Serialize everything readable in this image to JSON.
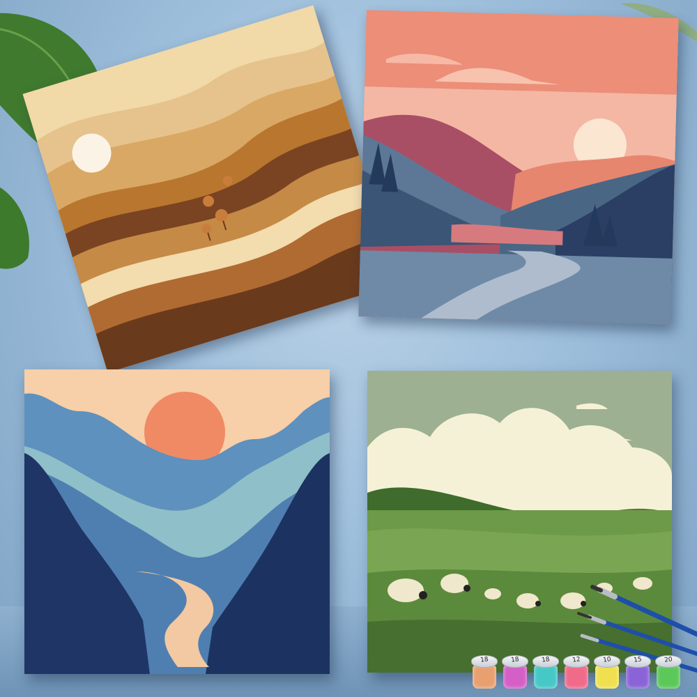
{
  "scene": {
    "paintings": [
      {
        "name": "desert-hills-painting",
        "subject": "layered brown and sand rolling hills with white sun and small trees"
      },
      {
        "name": "sunset-river-valley-painting",
        "subject": "pink sky, mountains, pale sun and winding river"
      },
      {
        "name": "blue-mountain-valley-painting",
        "subject": "peach sky, orange sun, blue mountains and winding path"
      },
      {
        "name": "sheep-meadow-painting",
        "subject": "green meadow with clouds, trees and grazing sheep"
      }
    ],
    "paint_pots": [
      {
        "label": "18",
        "color": "#e9a070"
      },
      {
        "label": "18",
        "color": "#d45fc6"
      },
      {
        "label": "18",
        "color": "#46c8c6"
      },
      {
        "label": "12",
        "color": "#f06a8a"
      },
      {
        "label": "10",
        "color": "#f0e050"
      },
      {
        "label": "15",
        "color": "#8a64d6"
      },
      {
        "label": "20",
        "color": "#5cc85a"
      }
    ]
  },
  "colors": {
    "wall": "#9ebfdc",
    "brush_handle": "#1e4fa8"
  }
}
